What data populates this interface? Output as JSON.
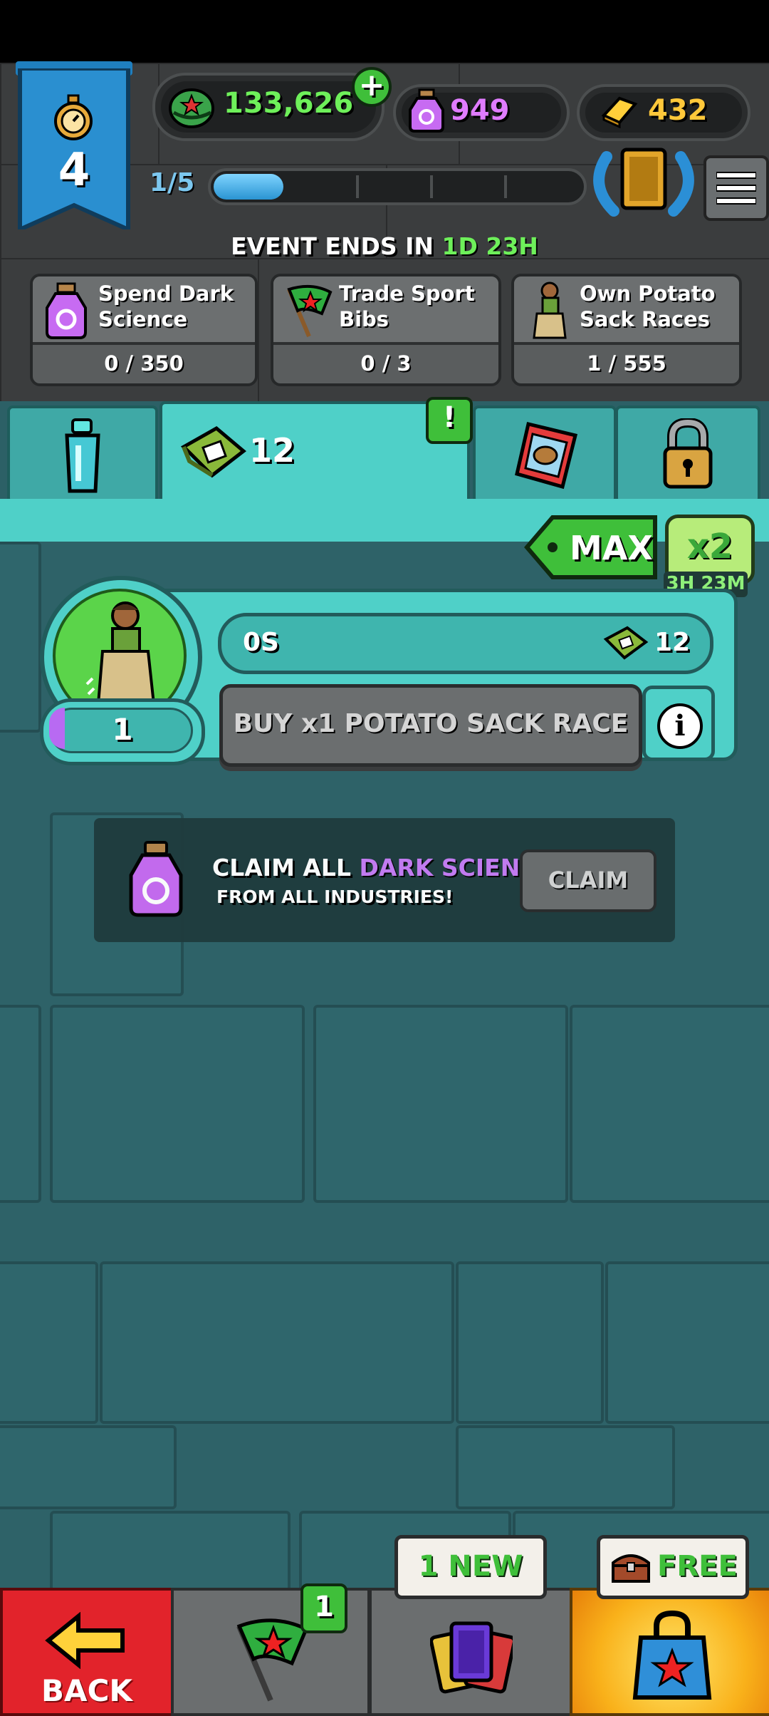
{
  "hud": {
    "level": "4",
    "helmets": "133,626",
    "dark_science": "949",
    "gold": "432",
    "progress_text": "1/5",
    "progress_fraction": 0.2
  },
  "event": {
    "prefix": "EVENT ENDS IN",
    "time": "1D 23H",
    "tasks": [
      {
        "label": "Spend Dark Science",
        "progress": "0 / 350",
        "icon": "dark-science-jar-icon"
      },
      {
        "label": "Trade Sport Bibs",
        "progress": "0 / 3",
        "icon": "green-flag-icon"
      },
      {
        "label": "Own Potato Sack Races",
        "progress": "1 / 555",
        "icon": "potato-sack-racer-icon"
      }
    ]
  },
  "tabs": {
    "sport_bibs_count": "12",
    "alert_mark": "!"
  },
  "buy": {
    "max_label": "MAX",
    "multiplier": "x2",
    "multiplier_timer": "3H 23M",
    "timer": "0S",
    "reward": "12",
    "owned": "1",
    "button": "BUY x1 POTATO SACK RACE",
    "info": "i"
  },
  "claim_banner": {
    "prefix": "CLAIM ALL",
    "highlight": "DARK SCIENCE",
    "line2": "FROM ALL INDUSTRIES!",
    "button": "CLAIM"
  },
  "bottom": {
    "back": "BACK",
    "flag_badge": "1",
    "cards_badge": "1 NEW",
    "shop_badge": "FREE"
  },
  "colors": {
    "accent_teal": "#4fd0c8",
    "green": "#6ef05a",
    "purple": "#e07cff",
    "gold": "#ffc83a",
    "back_red": "#e2232b"
  }
}
